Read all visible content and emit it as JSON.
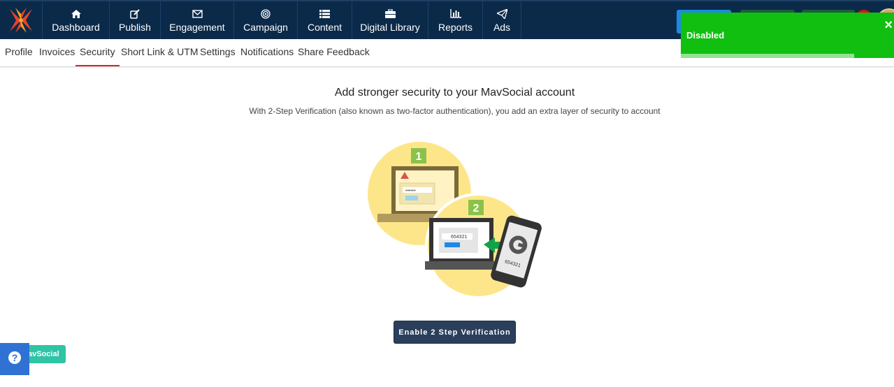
{
  "topnav": {
    "items": [
      {
        "label": "Dashboard",
        "icon": "home-icon"
      },
      {
        "label": "Publish",
        "icon": "edit-icon"
      },
      {
        "label": "Engagement",
        "icon": "envelope-icon"
      },
      {
        "label": "Campaign",
        "icon": "target-icon"
      },
      {
        "label": "Content",
        "icon": "list-icon"
      },
      {
        "label": "Digital Library",
        "icon": "briefcase-icon"
      },
      {
        "label": "Reports",
        "icon": "bar-chart-icon"
      },
      {
        "label": "Ads",
        "icon": "paper-plane-icon"
      }
    ]
  },
  "subnav": {
    "tabs": [
      {
        "label": "Profile"
      },
      {
        "label": "Invoices"
      },
      {
        "label": "Security",
        "active": true
      },
      {
        "label": "Short Link & UTM"
      },
      {
        "label": "Settings"
      },
      {
        "label": "Notifications"
      },
      {
        "label": "Share Feedback"
      }
    ]
  },
  "toast": {
    "title": "Disabled",
    "close": "×",
    "color": "#11bf11"
  },
  "main": {
    "title": "Add stronger security to your MavSocial account",
    "subtitle": "With 2-Step Verification (also known as two-factor authentication), you add an extra layer of security to account",
    "illustration": {
      "step1": "1",
      "step2": "2",
      "password_mask": "••••••",
      "code": "654321",
      "phone_code": "654321"
    },
    "enable_button": "Enable 2 Step Verification"
  },
  "footer": {
    "brand_chip": "avSocial",
    "help_icon": "question-circle-icon"
  },
  "colors": {
    "nav_bg": "#0b2a4a",
    "active_tab_underline": "#d9242c",
    "button_bg": "#2b3f5c",
    "help_bg": "#2f72d4",
    "brand_chip_bg": "#2ec4a5"
  }
}
